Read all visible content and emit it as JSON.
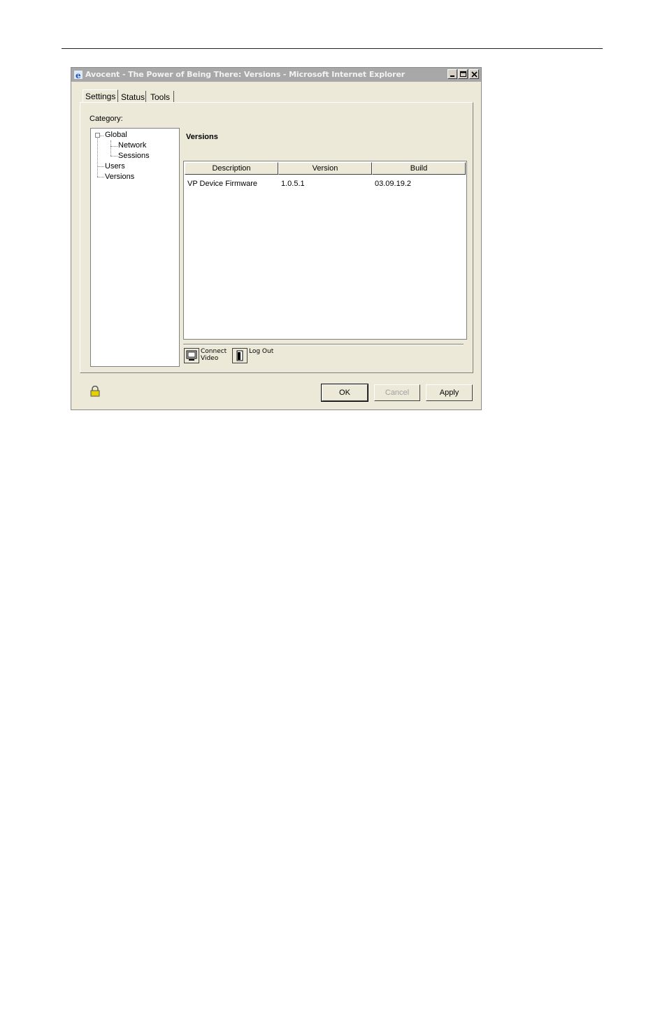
{
  "window": {
    "title": "Avocent - The Power of Being There: Versions - Microsoft Internet Explorer"
  },
  "tabs": [
    {
      "label": "Settings",
      "selected": true
    },
    {
      "label": "Status",
      "selected": false
    },
    {
      "label": "Tools",
      "selected": false
    }
  ],
  "category": {
    "label": "Category:",
    "tree": [
      {
        "label": "Global",
        "children": [
          "Network",
          "Sessions"
        ]
      },
      {
        "label": "Users"
      },
      {
        "label": "Versions"
      }
    ]
  },
  "main": {
    "title": "Versions",
    "table": {
      "headers": [
        "Description",
        "Version",
        "Build"
      ],
      "rows": [
        [
          "VP Device Firmware",
          "1.0.5.1",
          "03.09.19.2"
        ]
      ]
    }
  },
  "toolbar": {
    "connect_video_line1": "Connect",
    "connect_video_line2": "Video",
    "log_out": "Log Out"
  },
  "footer": {
    "ok": "OK",
    "cancel": "Cancel",
    "apply": "Apply"
  },
  "colors": {
    "dialog_bg": "#ece9d8",
    "titlebar_bg": "#a8a8a8",
    "lock": "#e8d000"
  }
}
